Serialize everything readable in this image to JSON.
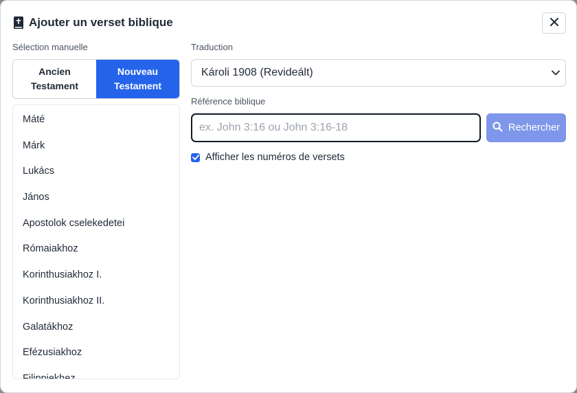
{
  "dialog": {
    "title": "Ajouter un verset biblique",
    "icon": "bible-icon",
    "close_icon": "close-icon"
  },
  "manual": {
    "label": "Sélection manuelle",
    "testaments": [
      {
        "label": "Ancien\nTestament",
        "active": false
      },
      {
        "label": "Nouveau\nTestament",
        "active": true
      }
    ],
    "books": [
      "Máté",
      "Márk",
      "Lukács",
      "János",
      "Apostolok cselekedetei",
      "Rómaiakhoz",
      "Korinthusiakhoz I.",
      "Korinthusiakhoz II.",
      "Galatákhoz",
      "Efézusiakhoz",
      "Filippiekhez"
    ]
  },
  "translation": {
    "label": "Traduction",
    "selected": "Károli 1908 (Revideált)"
  },
  "reference": {
    "label": "Référence biblique",
    "placeholder": "ex. John 3:16 ou John 3:16-18",
    "value": "",
    "search_label": "Rechercher",
    "search_icon": "search-icon"
  },
  "options": {
    "show_verse_numbers_label": "Afficher les numéros de versets",
    "show_verse_numbers": true
  },
  "colors": {
    "accent": "#2563eb",
    "search_button": "#7f97ea"
  }
}
